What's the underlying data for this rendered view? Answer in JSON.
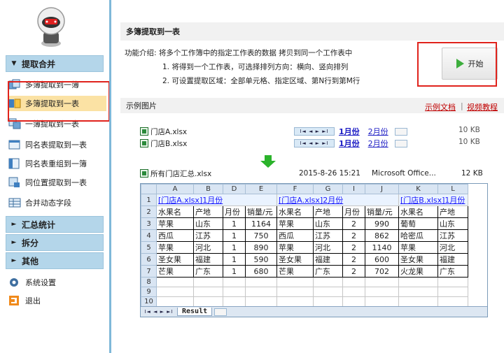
{
  "sidebar": {
    "groups": [
      {
        "label": "提取合并",
        "arrow": "▼"
      },
      {
        "label": "汇总统计",
        "arrow": "►"
      },
      {
        "label": "拆分",
        "arrow": "►"
      },
      {
        "label": "其他",
        "arrow": "►"
      }
    ],
    "items": [
      {
        "label": "多簿提取到一簿",
        "icon": "multi-book-icon"
      },
      {
        "label": "多簿提取到一表",
        "icon": "multi-sheet-icon"
      },
      {
        "label": "一簿提取到一表",
        "icon": "book-to-sheet-icon"
      },
      {
        "label": "同名表提取到一表",
        "icon": "same-name-sheet-icon"
      },
      {
        "label": "同名表重组到一簿",
        "icon": "regroup-icon"
      },
      {
        "label": "同位置提取到一表",
        "icon": "same-position-icon"
      },
      {
        "label": "合并动态字段",
        "icon": "dynamic-field-icon"
      }
    ],
    "settings_label": "系统设置",
    "exit_label": "退出",
    "colors": {
      "active": "#fbe2a4",
      "header": "#b4d6ea"
    }
  },
  "main": {
    "title": "多簿提取到一表",
    "description": "功能介绍: 将多个工作簿中的指定工作表的数据 拷贝到同一个工作表中",
    "bullets": [
      "1. 将得到一个工作表，可选择排列方向：横向、竖向排列",
      "2. 可设置提取区域：全部单元格、指定区域、第N行到第M行"
    ],
    "start_label": "开始",
    "example_label": "示例图片",
    "doc_link": "示例文档",
    "video_link": "视频教程"
  },
  "example": {
    "files": [
      {
        "name": "门店A.xlsx",
        "size": "10 KB"
      },
      {
        "name": "门店B.xlsx",
        "size": "10 KB"
      }
    ],
    "tabs": [
      "1月份",
      "2月份"
    ],
    "merged": {
      "name": "所有门店汇总.xlsx",
      "date": "2015-8-26 15:21",
      "app": "Microsoft Office...",
      "size": "12 KB"
    },
    "columns": [
      "A",
      "B",
      "D",
      "E",
      "F",
      "G",
      "I",
      "J",
      "K",
      "L"
    ],
    "row_numbers": [
      "1",
      "2",
      "3",
      "4",
      "5",
      "6",
      "7",
      "8",
      "9",
      "10"
    ],
    "row1": [
      "[门店A.xlsx]1月份",
      "[门店A.xlsx]2月份",
      "[门店B.xlsx]1月份"
    ],
    "header_row": [
      "水果名",
      "产地",
      "月份",
      "销量/元",
      "水果名",
      "产地",
      "月份",
      "销量/元",
      "水果名",
      "产地"
    ],
    "rows": [
      [
        "苹果",
        "山东",
        "1",
        "1164",
        "苹果",
        "山东",
        "2",
        "990",
        "葡萄",
        "山东"
      ],
      [
        "西瓜",
        "江苏",
        "1",
        "750",
        "西瓜",
        "江苏",
        "2",
        "862",
        "哈密瓜",
        "江苏"
      ],
      [
        "苹果",
        "河北",
        "1",
        "890",
        "苹果",
        "河北",
        "2",
        "1140",
        "苹果",
        "河北"
      ],
      [
        "圣女果",
        "福建",
        "1",
        "590",
        "圣女果",
        "福建",
        "2",
        "600",
        "圣女果",
        "福建"
      ],
      [
        "芒果",
        "广东",
        "1",
        "680",
        "芒果",
        "广东",
        "2",
        "702",
        "火龙果",
        "广东"
      ]
    ],
    "sheet_tab": "Result"
  }
}
